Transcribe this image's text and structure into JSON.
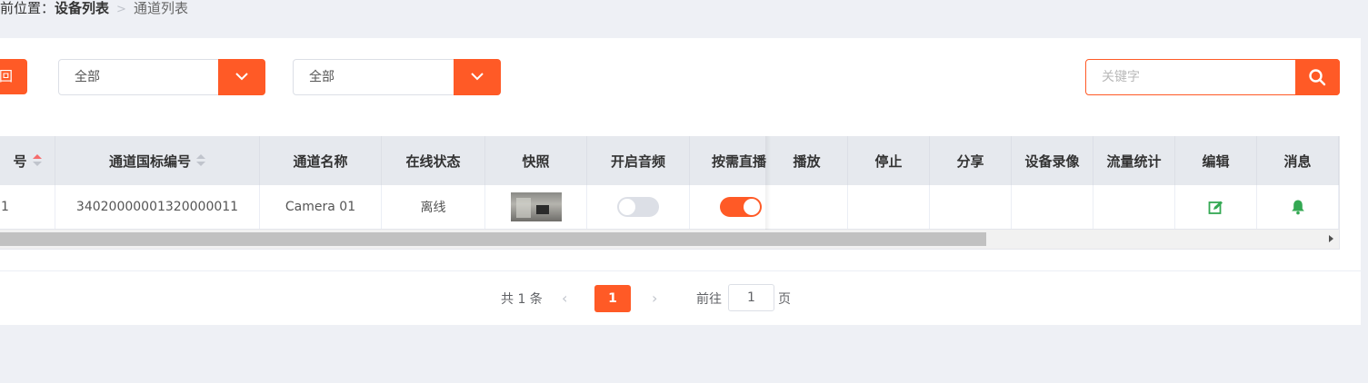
{
  "breadcrumb": {
    "prefix": "前位置：",
    "parent": "设备列表",
    "current": "通道列表"
  },
  "toolbar": {
    "back_label": "回",
    "select1_value": "全部",
    "select2_value": "全部",
    "search_placeholder": "关键字"
  },
  "table": {
    "columns": [
      "号",
      "通道国标编号",
      "通道名称",
      "在线状态",
      "快照",
      "开启音频",
      "按需直播",
      "播放",
      "停止",
      "分享",
      "设备录像",
      "流量统计",
      "编辑",
      "消息"
    ],
    "rows": [
      {
        "index": "1",
        "channel_id": "34020000001320000011",
        "name": "Camera 01",
        "status": "离线",
        "audio_enabled": false,
        "on_demand_live": true
      }
    ]
  },
  "pagination": {
    "total": "共 1 条",
    "current_page": "1",
    "goto_label": "前往",
    "goto_value": "1",
    "page_unit": "页"
  },
  "colors": {
    "accent": "#ff5a26",
    "edit_icon": "#34a853",
    "bell_icon": "#34a853"
  }
}
